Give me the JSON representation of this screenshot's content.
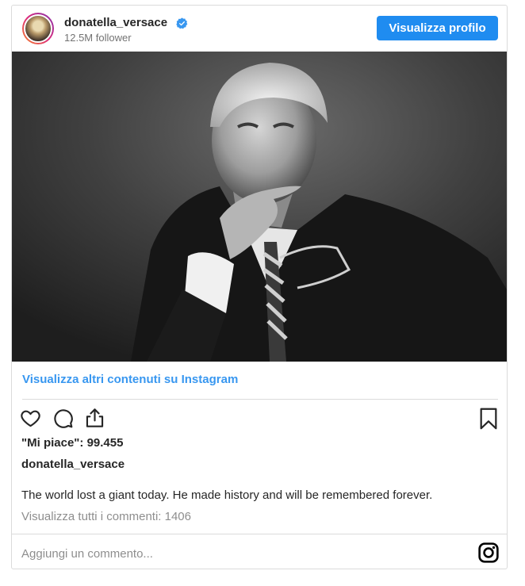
{
  "header": {
    "username": "donatella_versace",
    "followers": "12.5M follower",
    "profile_button": "Visualizza profilo",
    "avatar_icon": "profile-avatar",
    "verified_icon": "verified-badge-icon",
    "accent_color": "#1f8cf0"
  },
  "post": {
    "image_alt": "black-and-white portrait photo",
    "more_link": "Visualizza altri contenuti su Instagram",
    "likes": "\"Mi piace\": 99.455",
    "caption_username": "donatella_versace",
    "caption": "The world lost a giant today. He made history and will be remembered forever.",
    "view_comments": "Visualizza tutti i commenti: 1406",
    "comment_placeholder": "Aggiungi un commento..."
  },
  "actions": {
    "like_icon": "heart-icon",
    "comment_icon": "comment-icon",
    "share_icon": "share-icon",
    "save_icon": "bookmark-icon",
    "brand_icon": "instagram-icon"
  }
}
